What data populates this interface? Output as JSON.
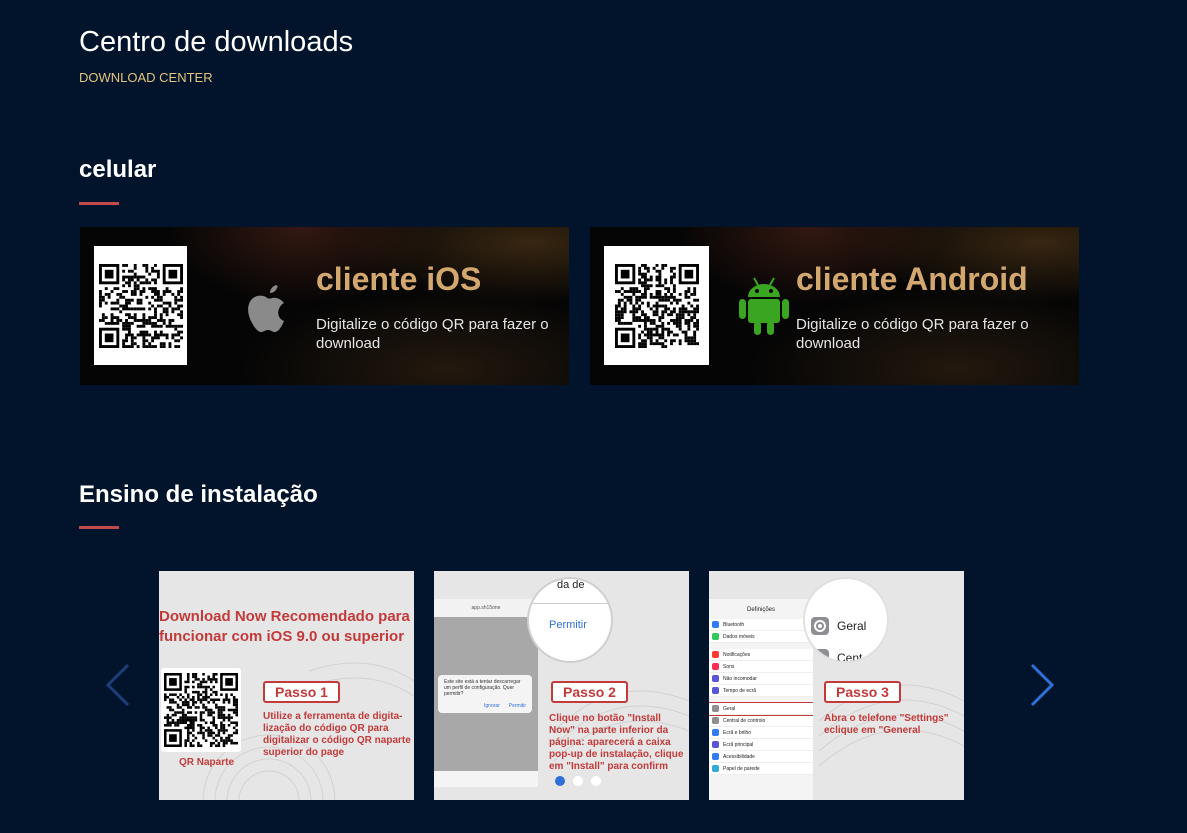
{
  "header": {
    "title": "Centro de downloads",
    "subtitle": "DOWNLOAD CENTER"
  },
  "mobile_section": {
    "title": "celular",
    "cards": [
      {
        "title": "cliente iOS",
        "description": "Digitalize o código QR para fazer o download",
        "icon": "apple-icon"
      },
      {
        "title": "cliente Android",
        "description": "Digitalize o código QR para fazer o download",
        "icon": "android-icon"
      }
    ]
  },
  "install_section": {
    "title": "Ensino de instalação",
    "slides": [
      {
        "headline": "Download Now Recomendado para funcionar com iOS 9.0 ou superior",
        "step": "Passo 1",
        "text": "Utilize a ferramenta de digita-lização do código QR para digitalizar o código QR naparte superior do page",
        "qr_caption": "QR Naparte"
      },
      {
        "step": "Passo 2",
        "text": "Clique no botão \"Install Now\" na parte inferior da página: aparecerá a caixa pop-up de instalação, clique em \"Install\" para confirm",
        "zoom_top": "da de",
        "zoom_button": "Permitir",
        "dialog_text": "Este site está a tentar descarregar um perfil de configuração. Quer permitir?",
        "dialog_cancel": "Ignorar",
        "dialog_ok": "Permitir",
        "url": "app.sh15one"
      },
      {
        "step": "Passo 3",
        "text": "Abra o telefone \"Settings\" eclique em \"General",
        "zoom_item": "Geral",
        "zoom_item2": "Cent",
        "settings_title": "Definições",
        "settings_items": [
          "Bluetooth",
          "Dados móveis",
          "Notificações",
          "Sons",
          "Não incomodar",
          "Tempo de ecrã",
          "Geral",
          "Central de controlo",
          "Ecrã e brilho",
          "Ecrã principal",
          "Acessibilidade",
          "Papel de parede"
        ]
      }
    ],
    "dots": 3,
    "active_dot": 0
  },
  "colors": {
    "background": "#02142b",
    "accent_red": "#c24a4a",
    "gold": "#d2a86f",
    "subtitle": "#e2c47e",
    "arrow_blue": "#2e6fd8"
  }
}
